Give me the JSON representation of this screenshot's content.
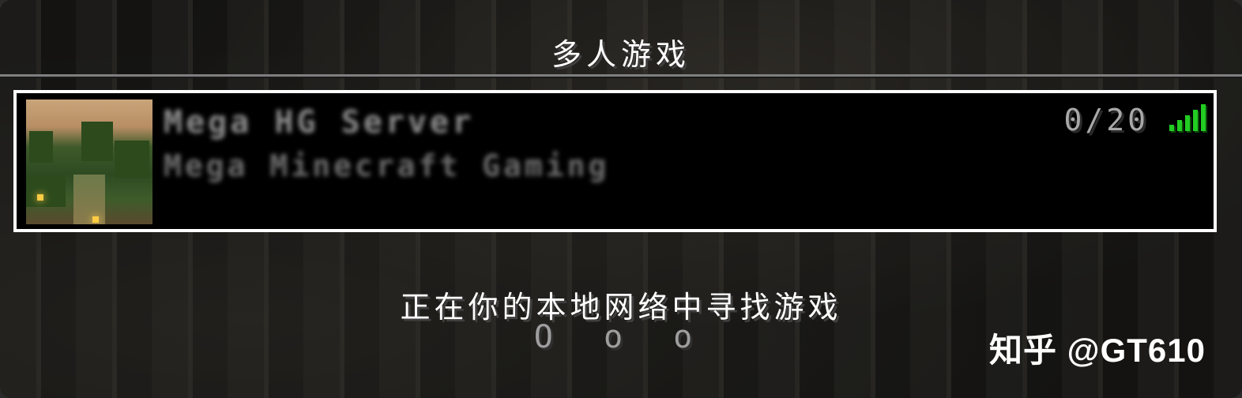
{
  "screen": {
    "title": "多人游戏"
  },
  "server": {
    "name": "Mega HG Server",
    "motd": "Mega Minecraft Gaming",
    "player_count": "0/20",
    "signal_icon": "signal-bars-icon",
    "signal_color": "#22cc22",
    "signal_level": 5,
    "signal_max": 5
  },
  "status": {
    "message": "正在你的本地网络中寻找游戏",
    "dots": "O o o"
  },
  "watermark": {
    "text": "知乎 @GT610"
  }
}
